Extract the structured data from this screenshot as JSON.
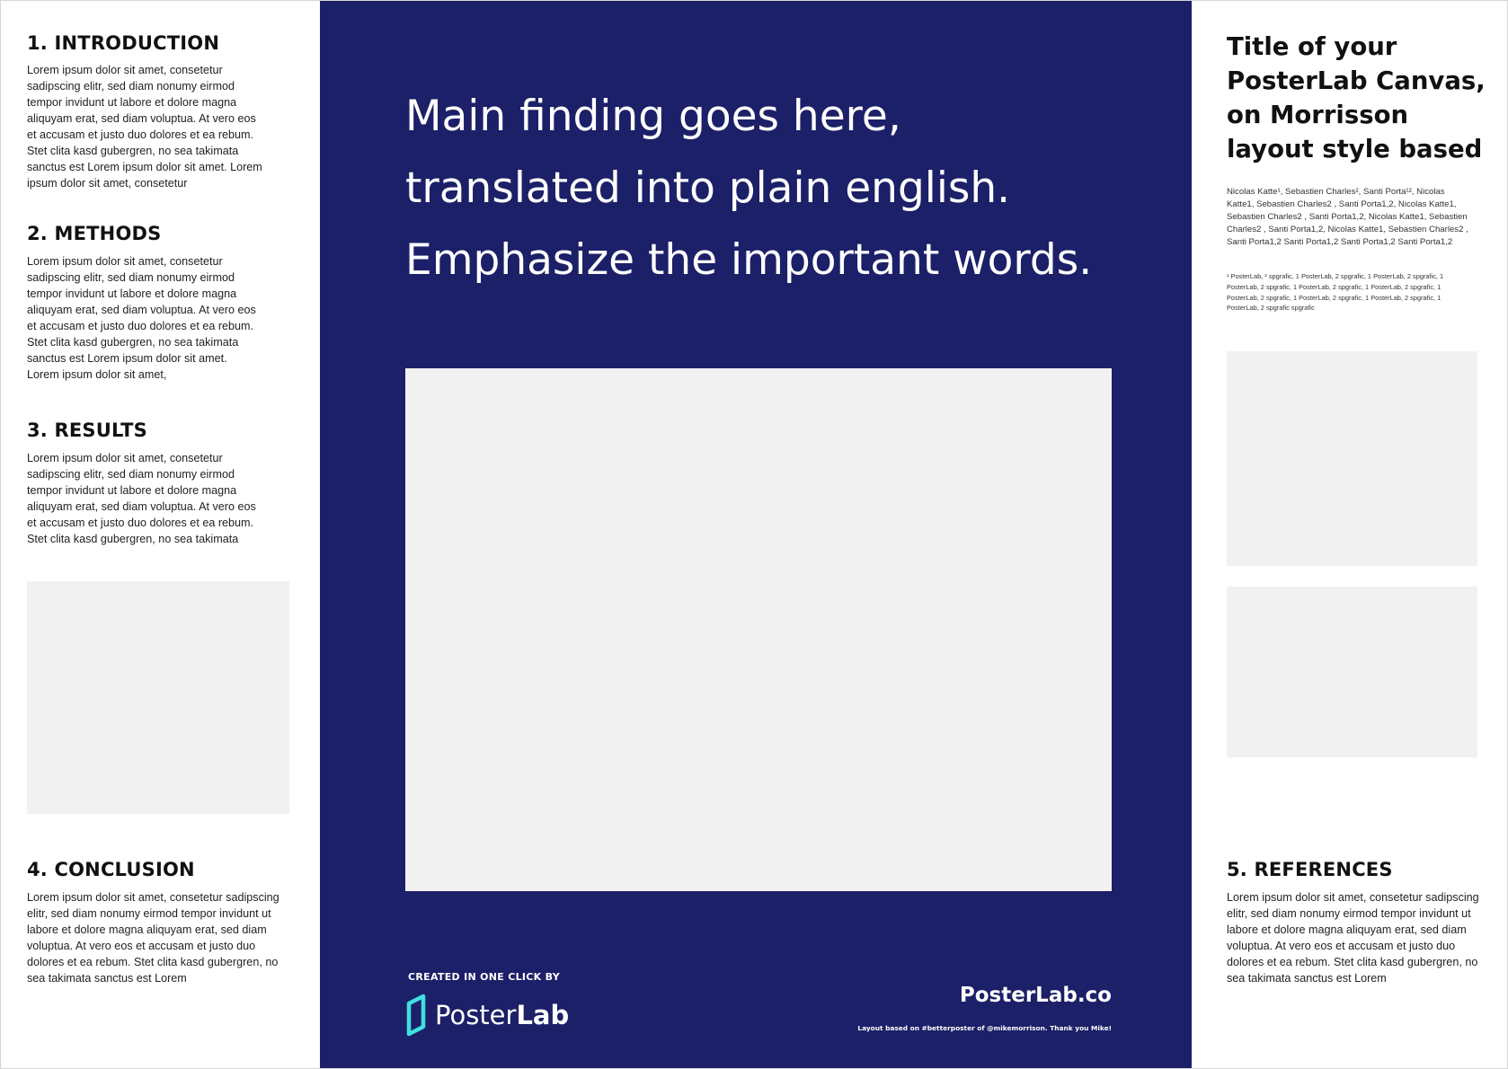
{
  "sections": {
    "introduction": {
      "heading": "1. INTRODUCTION",
      "body": "Lorem ipsum dolor sit amet, consetetur sadipscing elitr, sed diam nonumy eirmod tempor invidunt ut labore et dolore magna aliquyam erat, sed diam voluptua. At vero eos et accusam et justo duo dolores et ea rebum. Stet clita kasd gubergren, no sea takimata sanctus est Lorem ipsum dolor sit amet. Lorem ipsum dolor sit amet, consetetur"
    },
    "methods": {
      "heading": "2. METHODS",
      "body": "Lorem ipsum dolor sit amet, consetetur sadipscing elitr, sed diam nonumy eirmod tempor invidunt ut labore et dolore magna aliquyam erat, sed diam voluptua. At vero eos et accusam et justo duo dolores et ea rebum. Stet clita kasd gubergren, no sea takimata sanctus est Lorem ipsum dolor sit amet. Lorem ipsum dolor sit amet,"
    },
    "results": {
      "heading": "3. RESULTS",
      "body": "Lorem ipsum dolor sit amet, consetetur sadipscing elitr, sed diam nonumy eirmod tempor invidunt ut labore et dolore magna aliquyam erat, sed diam voluptua. At vero eos et accusam et justo duo dolores et ea rebum. Stet clita kasd gubergren, no sea takimata"
    },
    "conclusion": {
      "heading": "4. CONCLUSION",
      "body": "Lorem ipsum dolor sit amet, consetetur sadipscing elitr, sed diam nonumy eirmod tempor invidunt ut labore et dolore magna aliquyam erat, sed diam voluptua. At vero eos et accusam et justo duo dolores et ea rebum. Stet clita kasd gubergren, no sea takimata sanctus est Lorem"
    },
    "references": {
      "heading": "5. REFERENCES",
      "body": "Lorem ipsum dolor sit amet, consetetur sadipscing elitr, sed diam nonumy eirmod tempor invidunt ut labore et dolore magna aliquyam erat, sed diam voluptua. At vero eos et accusam et justo duo dolores et ea rebum. Stet clita kasd gubergren, no sea takimata sanctus est Lorem"
    }
  },
  "main_finding": {
    "line1": "Main finding goes here,",
    "line2": "translated into plain english.",
    "line3": "Emphasize the important words."
  },
  "poster": {
    "title": "Title of your PosterLab Canvas, on Morrisson layout style based",
    "authors": "Nicolas Katte¹, Sebastien Charles², Santi Porta¹², Nicolas Katte1, Sebastien Charles2 , Santi Porta1,2, Nicolas Katte1, Sebastien Charles2 , Santi Porta1,2, Nicolas Katte1, Sebastien Charles2 , Santi Porta1,2, Nicolas Katte1, Sebastien Charles2 , Santi Porta1,2 Santi Porta1,2 Santi Porta1,2 Santi Porta1,2",
    "affiliations": "¹ PosterLab, ² spgrafic, 1 PosterLab, 2 spgrafic, 1 PosterLab, 2 spgrafic, 1 PosterLab, 2 spgrafic, 1 PosterLab, 2 spgrafic, 1 PosterLab, 2 spgrafic, 1 PosterLab, 2 spgrafic, 1 PosterLab, 2 spgrafic, 1 PosterLab, 2 spgrafic, 1 PosterLab, 2 spgrafic spgrafic"
  },
  "footer": {
    "created_by": "CREATED IN ONE CLICK BY",
    "brand_light": "Poster",
    "brand_bold": "Lab",
    "logo_icon": "posterlab-logo-icon",
    "site_url": "PosterLab.co",
    "credit": "Layout based on #betterposter of @mikemorrison. Thank you Mike!"
  },
  "colors": {
    "center_panel": "#1c2068",
    "placeholder": "#f1f1f1",
    "logo_accent": "#3ee0e0",
    "text_dark": "#111111",
    "text_light": "#ffffff"
  }
}
